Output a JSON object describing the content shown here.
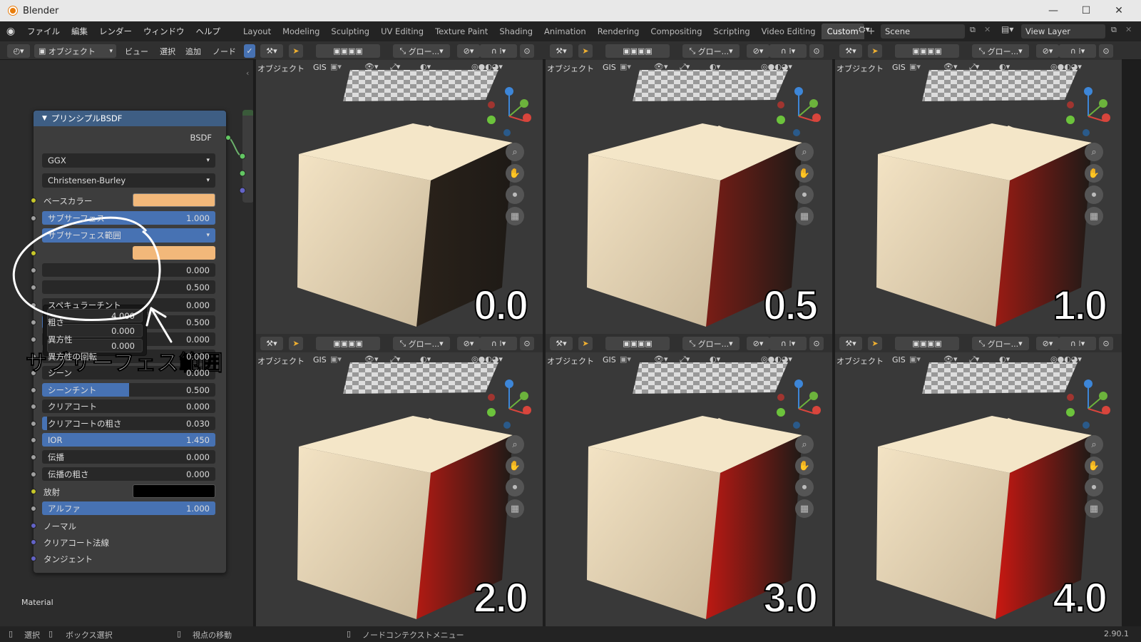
{
  "window": {
    "title": "Blender"
  },
  "menu": [
    "ファイル",
    "編集",
    "レンダー",
    "ウィンドウ",
    "ヘルプ"
  ],
  "workspaces": [
    "Layout",
    "Modeling",
    "Sculpting",
    "UV Editing",
    "Texture Paint",
    "Shading",
    "Animation",
    "Rendering",
    "Compositing",
    "Scripting",
    "Video Editing",
    "Custom"
  ],
  "active_workspace": "Custom",
  "scene": {
    "name": "Scene",
    "view_layer": "View Layer"
  },
  "node_header": {
    "mode": "オブジェクト",
    "view": "ビュー",
    "select": "選択",
    "add": "追加",
    "node": "ノード"
  },
  "node": {
    "title": "プリンシプルBSDF",
    "output": "BSDF",
    "distribution": "GGX",
    "subsurface_method": "Christensen-Burley",
    "base_color_label": "ベースカラー",
    "subsurface": {
      "label": "サブサーフェス",
      "value": "1.000"
    },
    "subsurface_radius_label": "サブサーフェス範囲",
    "radius_popup": [
      "4.000",
      "0.000",
      "0.000"
    ],
    "hidden_rows": [
      {
        "value": "0.000"
      },
      {
        "value": "0.500"
      }
    ],
    "specular_tint": {
      "label": "スペキュラーチント",
      "value": "0.000"
    },
    "roughness": {
      "label": "粗さ",
      "value": "0.500"
    },
    "anisotropic": {
      "label": "異方性",
      "value": "0.000"
    },
    "anisotropic_rotation": {
      "label": "異方性の回転",
      "value": "0.000"
    },
    "sheen": {
      "label": "シーン",
      "value": "0.000"
    },
    "sheen_tint": {
      "label": "シーンチント",
      "value": "0.500"
    },
    "clearcoat": {
      "label": "クリアコート",
      "value": "0.000"
    },
    "clearcoat_roughness": {
      "label": "クリアコートの粗さ",
      "value": "0.030"
    },
    "ior": {
      "label": "IOR",
      "value": "1.450"
    },
    "transmission": {
      "label": "伝播",
      "value": "0.000"
    },
    "transmission_roughness": {
      "label": "伝播の粗さ",
      "value": "0.000"
    },
    "emission_label": "放射",
    "alpha": {
      "label": "アルファ",
      "value": "1.000"
    },
    "normal_label": "ノーマル",
    "clearcoat_normal_label": "クリアコート法線",
    "tangent_label": "タンジェント"
  },
  "material_label": "Material",
  "annotation": {
    "text": "サブサーフェス範囲"
  },
  "viewport": {
    "mode": "オブジェクト",
    "gis": "GIS",
    "transform": "グロー..."
  },
  "viewports": [
    {
      "label": "0.0"
    },
    {
      "label": "0.5"
    },
    {
      "label": "1.0"
    },
    {
      "label": "2.0"
    },
    {
      "label": "3.0"
    },
    {
      "label": "4.0"
    }
  ],
  "statusbar": {
    "select": "選択",
    "box_select": "ボックス選択",
    "move_view": "視点の移動",
    "context_menu": "ノードコンテクストメニュー",
    "version": "2.90.1"
  },
  "colors": {
    "base_color": "#f2b87a",
    "red_scatter": "#c81a10",
    "cube_light": "#f0dfc0",
    "accent": "#4772b3"
  }
}
